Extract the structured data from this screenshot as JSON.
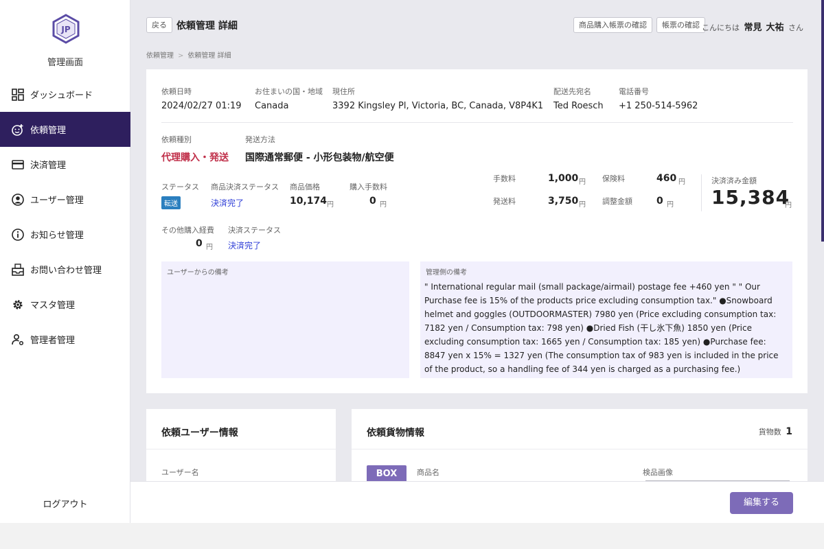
{
  "sidebar": {
    "logo_text": "JP",
    "title": "管理画面",
    "items": [
      {
        "label": "ダッシュボード",
        "icon": "dashboard-icon",
        "active": false
      },
      {
        "label": "依頼管理",
        "icon": "smile-plus-icon",
        "active": true
      },
      {
        "label": "決済管理",
        "icon": "card-icon",
        "active": false
      },
      {
        "label": "ユーザー管理",
        "icon": "user-circle-icon",
        "active": false
      },
      {
        "label": "お知らせ管理",
        "icon": "info-icon",
        "active": false
      },
      {
        "label": "お問い合わせ管理",
        "icon": "inbox-icon",
        "active": false
      },
      {
        "label": "マスタ管理",
        "icon": "gear-icon",
        "active": false
      },
      {
        "label": "管理者管理",
        "icon": "admin-icon",
        "active": false
      }
    ],
    "logout": "ログアウト"
  },
  "header": {
    "back": "戻る",
    "title": "依頼管理 詳細",
    "btn_purchase_doc": "商品購入帳票の確認",
    "btn_doc": "帳票の確認",
    "greeting_prefix": "こんにちは",
    "user_last": "常見",
    "user_first": "大祐",
    "greeting_suffix": "さん"
  },
  "breadcrumb": [
    "依頼管理",
    "依頼管理 詳細"
  ],
  "details": {
    "date_label": "依頼日時",
    "date": "2024/02/27 01:19",
    "country_label": "お住まいの国・地域",
    "country": "Canada",
    "address_label": "現住所",
    "address": "3392 Kingsley Pl, Victoria, BC, Canada, V8P4K1",
    "recipient_label": "配送先宛名",
    "recipient": "Ted Roesch",
    "phone_label": "電話番号",
    "phone": "+1 250-514-5962",
    "type_label": "依頼種別",
    "type": "代理購入・発送",
    "ship_label": "発送方法",
    "ship": "国際通常郵便 - 小形包装物/航空便",
    "status_label": "ステータス",
    "status": "転送",
    "item_pay_status_label": "商品決済ステータス",
    "item_pay_status": "決済完了",
    "price_label": "商品価格",
    "price": "10,174",
    "purchase_fee_label": "購入手数料",
    "purchase_fee": "0",
    "other_fee_label": "その他購入経費",
    "other_fee": "0",
    "pay_status_label": "決済ステータス",
    "pay_status": "決済完了",
    "yen": "円"
  },
  "fees": {
    "handling_label": "手数料",
    "handling": "1,000",
    "insurance_label": "保険料",
    "insurance": "460",
    "shipping_label": "発送料",
    "shipping": "3,750",
    "adjust_label": "調整金額",
    "adjust": "0",
    "paid_label": "決済済み金額",
    "paid": "15,384"
  },
  "memo": {
    "user_label": "ユーザーからの備考",
    "user_text": "",
    "admin_label": "管理側の備考",
    "admin_text": "\" International regular mail (small package/airmail) postage fee +460 yen \" \" Our Purchase fee is 15% of the products price excluding consumption tax.\" ●Snowboard helmet and goggles (OUTDOORMASTER) 7980 yen (Price excluding consumption tax: 7182 yen / Consumption tax: 798 yen) ●Dried Fish (干し氷下魚) 1850 yen (Price excluding consumption tax: 1665 yen / Consumption tax: 185 yen) ●Purchase fee: 8847 yen x 15% = 1327 yen (The consumption tax of 983 yen is included in the price of the product, so a handling fee of 344 yen is charged as a purchasing fee.)"
  },
  "user_card": {
    "title": "依頼ユーザー情報",
    "username_label": "ユーザー名"
  },
  "cargo_card": {
    "title": "依頼貨物情報",
    "count_label": "貨物数",
    "count": "1",
    "box": "BOX",
    "item_name_label": "商品名",
    "image_label": "検品画像"
  },
  "footer": {
    "edit": "編集する"
  },
  "colors": {
    "accent": "#2e1f5e",
    "button": "#7d6bb8",
    "link": "#2b3bd6",
    "alert": "#c0304a",
    "badge": "#2b7fbf"
  }
}
